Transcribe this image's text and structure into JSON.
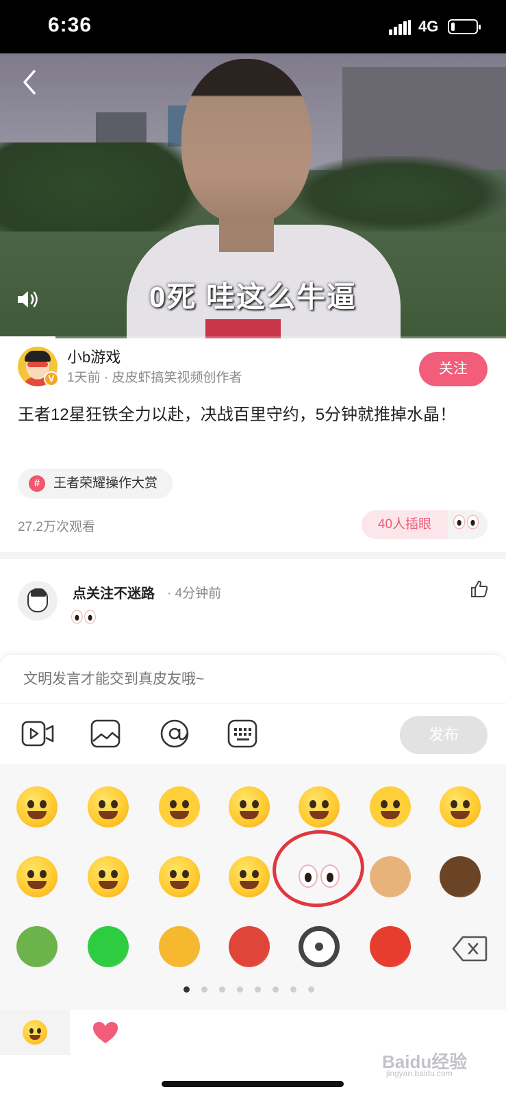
{
  "status_bar": {
    "time": "6:36",
    "network": "4G",
    "battery_level": 0.15
  },
  "video": {
    "caption": "0死  哇这么牛逼",
    "progress": 0.11
  },
  "author": {
    "name": "小b游戏",
    "meta": "1天前 · 皮皮虾搞笑视频创作者",
    "verified_badge": "V",
    "follow_label": "关注"
  },
  "post": {
    "title": "王者12星狂铁全力以赴，决战百里守约，5分钟就推掉水晶！",
    "topic_icon": "#",
    "topic": "王者荣耀操作大赏",
    "views": "27.2万次观看",
    "reaction_count": "40人插眼"
  },
  "comment": {
    "user": "点关注不迷路",
    "time": "· 4分钟前"
  },
  "input": {
    "placeholder": "文明发言才能交到真皮友哦~",
    "post_label": "发布",
    "toolbar": [
      "video-icon",
      "image-icon",
      "at-icon",
      "keyboard-icon"
    ]
  },
  "emoji_panel": {
    "rows": [
      [
        "smile-emoji",
        "laugh-emoji",
        "heart-eyes-emoji",
        "rofl-emoji",
        "grin-emoji",
        "cry-emoji",
        "shy-emoji"
      ],
      [
        "smirk-emoji",
        "shocked-emoji",
        "thinking-emoji",
        "facepalm-emoji",
        "peek-eyes-emoji",
        "doge-emoji",
        "bird-emoji"
      ],
      [
        "pineapple-emoji",
        "green-hat-emoji",
        "beer-emoji",
        "crayfish-emoji",
        "steering-wheel-emoji",
        "dong-emoji",
        "delete-icon"
      ]
    ],
    "selected": "peek-eyes-emoji",
    "page_count": 8,
    "current_page": 1
  },
  "colors": {
    "accent": "#f25d79",
    "highlight": "#e0383f"
  },
  "watermark": {
    "text": "Baidu经验",
    "sub": "jingyan.baidu.com"
  }
}
